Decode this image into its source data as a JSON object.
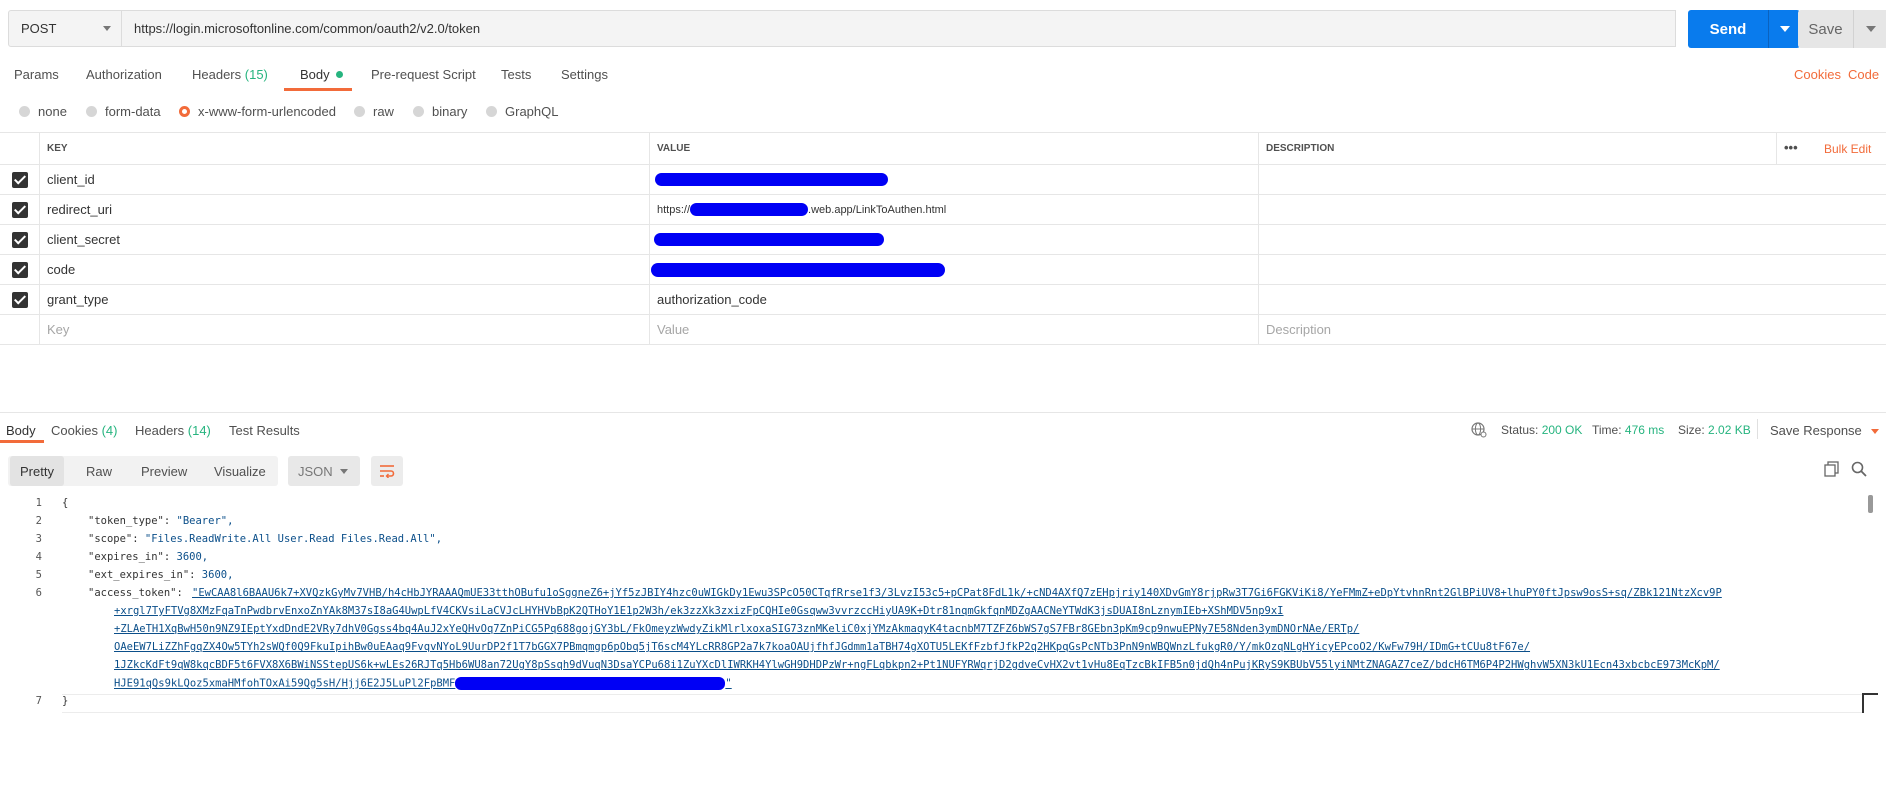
{
  "request": {
    "method": "POST",
    "url": "https://login.microsoftonline.com/common/oauth2/v2.0/token",
    "send_label": "Send",
    "save_label": "Save"
  },
  "tabs": {
    "params": "Params",
    "authorization": "Authorization",
    "headers": "Headers",
    "headers_count": "(15)",
    "body": "Body",
    "pre_request": "Pre-request Script",
    "tests": "Tests",
    "settings": "Settings",
    "cookies": "Cookies",
    "code": "Code"
  },
  "body_types": [
    "none",
    "form-data",
    "x-www-form-urlencoded",
    "raw",
    "binary",
    "GraphQL"
  ],
  "body_type_selected": "x-www-form-urlencoded",
  "table": {
    "headers": {
      "key": "KEY",
      "value": "VALUE",
      "description": "DESCRIPTION"
    },
    "more": "•••",
    "bulk_edit": "Bulk Edit",
    "rows": [
      {
        "key": "client_id",
        "value": ""
      },
      {
        "key": "redirect_uri",
        "value_prefix": "https://",
        "value_suffix": ".web.app/LinkToAuthen.html"
      },
      {
        "key": "client_secret",
        "value": ""
      },
      {
        "key": "code",
        "value": ""
      },
      {
        "key": "grant_type",
        "value": "authorization_code"
      }
    ],
    "placeholders": {
      "key": "Key",
      "value": "Value",
      "description": "Description"
    }
  },
  "response": {
    "tabs": {
      "body": "Body",
      "cookies": "Cookies",
      "cookies_count": "(4)",
      "headers": "Headers",
      "headers_count": "(14)",
      "test_results": "Test Results"
    },
    "status_label": "Status:",
    "status_value": "200 OK",
    "time_label": "Time:",
    "time_value": "476 ms",
    "size_label": "Size:",
    "size_value": "2.02 KB",
    "save_response": "Save Response",
    "view_modes": [
      "Pretty",
      "Raw",
      "Preview",
      "Visualize"
    ],
    "format": "JSON"
  },
  "code": {
    "line_numbers": [
      "1",
      "2",
      "3",
      "4",
      "5",
      "6",
      "7"
    ],
    "open_brace": "{",
    "close_brace": "}",
    "token_type_key": "\"token_type\": ",
    "token_type_val": "\"Bearer\",",
    "scope_key": "\"scope\": ",
    "scope_val": "\"Files.ReadWrite.All User.Read Files.Read.All\",",
    "expires_key": "\"expires_in\": ",
    "expires_val": "3600,",
    "ext_expires_key": "\"ext_expires_in\": ",
    "ext_expires_val": "3600,",
    "access_token_key": "\"access_token\": ",
    "access_token_lines": [
      "\"EwCAA8l6BAAU6k7+XVQzkGyMv7VHB/h4cHbJYRAAAQmUE33tthOBufu1oSggneZ6+jYf5zJBIY4hzc0uWIGkDy1Ewu3SPcO50CTqfRrse1f3/3LvzI53c5+pCPat8FdL1k/+cND4AXfQ7zEHpjriy140XDvGmY8rjpRw3T7Gi6FGKViKi8/YeFMmZ+eDpYtvhnRnt2GlBPiUV8+lhuPY0ftJpsw9osS+sq/ZBk121NtzXcv9P",
      "+xrgl7TyFTVg8XMzFqaTnPwdbrvEnxoZnYAk8M37sI8aG4UwpLfV4CKVsiLaCVJcLHYHVbBpK2QTHoY1E1p2W3h/ek3zzXk3zxizFpCQHIe0Gsqww3vvrzccHiyUA9K+Dtr81nqmGkfqnMDZgAACNeYTWdK3jsDUAI8nLznymIEb+XShMDV5np9xI",
      "+ZLAeTH1XqBwH50n9NZ9IEptYxdDndE2VRy7dhV0Ggss4bq4AuJ2xYeQHvOq7ZnPiCG5Pq688gojGY3bL/FkOmeyzWwdyZikMlrlxoxaSIG73znMKeliC0xjYMzAkmaqyK4tacnbM7TZFZ6bWS7gS7FBr8GEbn3pKm9cp9nwuEPNy7E58Nden3ymDNOrNAe/ERTp/",
      "OAeEW7LiZZhFgqZX4Ow5TYh2sWQf0Q9FkuIpihBw0uEAaq9FvqvNYoL9UurDP2f1T7bGGX7PBmqmgp6pObq5jT6scM4YLcRR8GP2a7k7koaOAUjfhfJGdmm1aTBH74gXOTU5LEKfFzbfJfkP2q2HKpqGsPcNTb3PnN9nWBQWnzLfukgR0/Y/mkOzqNLgHYicyEPcoO2/KwFw79H/IDmG+tCUu8tF67e/",
      "1JZkcKdFt9qW8kqcBDF5t6FVX8X6BWiNSStepUS6k+wLEs26RJTq5Hb6WU8an72UgY8pSsqh9dVuqN3DsaYCPu68i1ZuYXcDlIWRKH4YlwGH9DHDPzWr+ngFLqbkpn2+Pt1NUFYRWqrjD2gdveCvHX2vt1vHu8EqTzcBkIFB5n0jdQh4nPujKRyS9KBUbV55lyiNMtZNAGAZ7ceZ/bdcH6TM6P4P2HWghvW5XN3kU1Ecn43xbcbcE973McKpM/",
      "HJE91qQs9kLQoz5xmaHMfohTOxAi59Qg5sH/Hjj6E2J5LuPl2FpBMF"
    ],
    "access_token_end": "\""
  },
  "colors": {
    "accent": "#f26b3a",
    "send": "#097bed",
    "success": "#26b47f",
    "redaction": "#0000f5"
  }
}
